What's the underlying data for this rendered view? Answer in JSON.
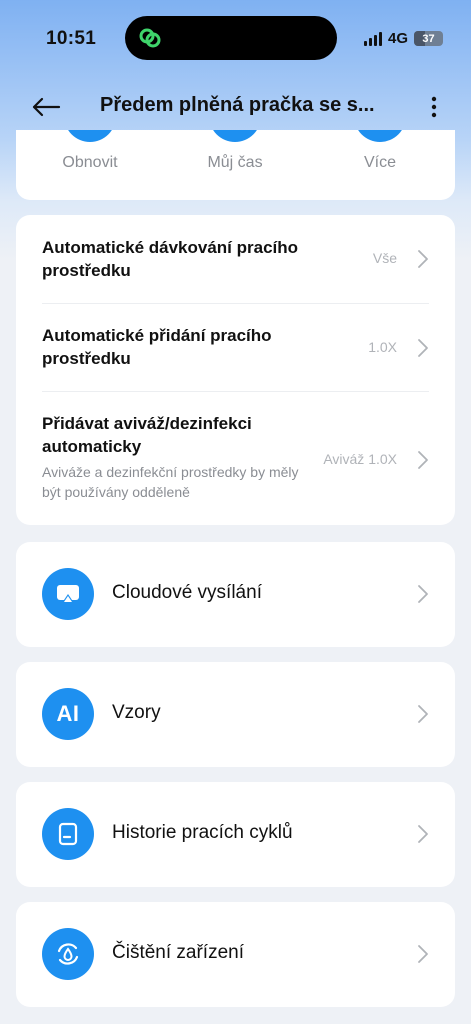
{
  "status_bar": {
    "time": "10:51",
    "network": "4G",
    "battery": "37",
    "battery_level": 0.37
  },
  "header": {
    "title": "Předem plněná pračka se s..."
  },
  "top_actions": [
    {
      "label": "Obnovit"
    },
    {
      "label": "Můj čas"
    },
    {
      "label": "Více"
    }
  ],
  "settings": [
    {
      "title": "Automatické dávkování pracího prostředku",
      "value": "Vše"
    },
    {
      "title": "Automatické přidání pracího prostředku",
      "value": "1.0X"
    },
    {
      "title": "Přidávat aviváž/dezinfekci automaticky",
      "desc": "Aviváže a dezinfekční prostředky by měly být používány odděleně",
      "value": "Aviváž 1.0X"
    }
  ],
  "menu": [
    {
      "label": "Cloudové vysílání",
      "icon": "cast-icon"
    },
    {
      "label": "Vzory",
      "icon": "ai-icon",
      "icon_text": "AI"
    },
    {
      "label": "Historie pracích cyklů",
      "icon": "document-icon"
    },
    {
      "label": "Čištění zařízení",
      "icon": "cleaning-icon"
    }
  ],
  "colors": {
    "accent": "#1e90f0",
    "muted_text": "#8a8d93",
    "value_text": "#b0b3b8"
  }
}
